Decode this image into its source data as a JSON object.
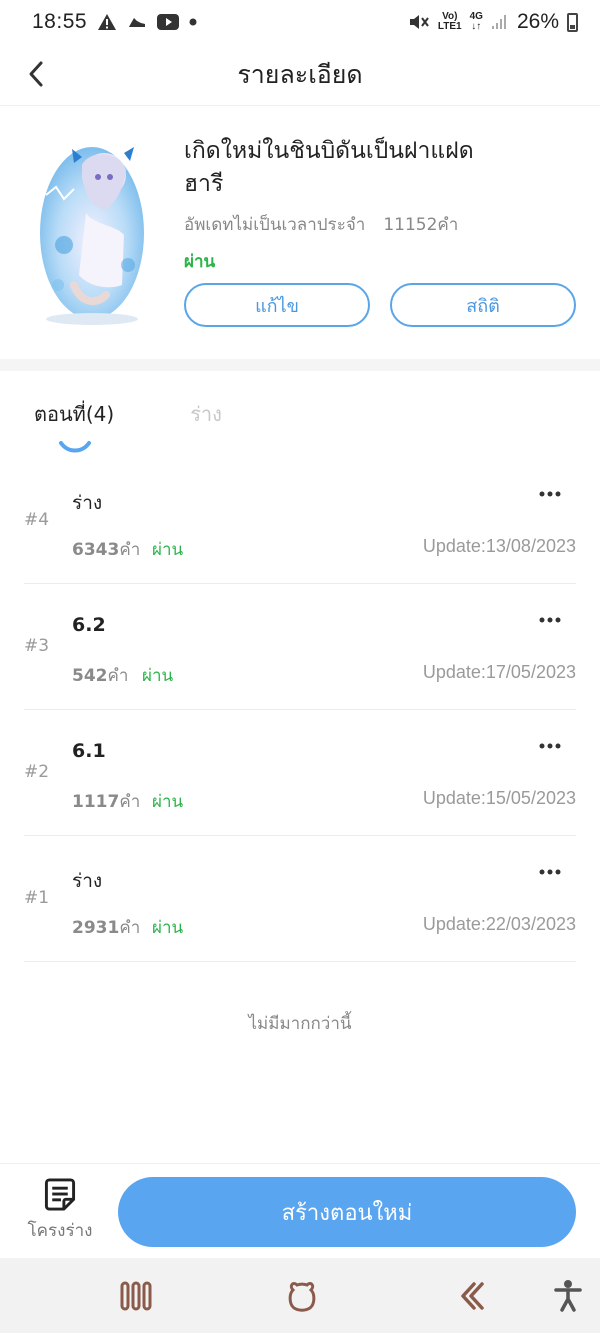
{
  "status_bar": {
    "time": "18:55",
    "battery": "26%",
    "volte": "Vo)",
    "lte": "LTE1",
    "network": "4G"
  },
  "header": {
    "title": "รายละเอียด"
  },
  "book": {
    "title_line1": "เกิดใหม่ในชินบิดันเป็นฝาแฝด",
    "title_line2": "ฮารี",
    "schedule": "อัพเดทไม่เป็นเวลาประจำ",
    "word_count": "11152คำ",
    "status": "ผ่าน",
    "edit_label": "แก้ไข",
    "stats_label": "สถิติ"
  },
  "tabs": {
    "chapters": "ตอนที่(4)",
    "drafts": "ร่าง"
  },
  "chapters": [
    {
      "num": "#4",
      "title": "ร่าง",
      "words": "6343",
      "unit": "คำ",
      "status": "ผ่าน",
      "update": "Update:13/08/2023"
    },
    {
      "num": "#3",
      "title": "6.2",
      "words": "542",
      "unit": "คำ",
      "status": "ผ่าน",
      "update": "Update:17/05/2023"
    },
    {
      "num": "#2",
      "title": "6.1",
      "words": "1117",
      "unit": "คำ",
      "status": "ผ่าน",
      "update": "Update:15/05/2023"
    },
    {
      "num": "#1",
      "title": "ร่าง",
      "words": "2931",
      "unit": "คำ",
      "status": "ผ่าน",
      "update": "Update:22/03/2023"
    }
  ],
  "no_more": "ไม่มีมากกว่านี้",
  "bottom": {
    "draft_label": "โครงร่าง",
    "create_label": "สร้างตอนใหม่"
  },
  "colors": {
    "accent": "#5aa5f0",
    "status_green": "#2cb34a"
  },
  "icons": {
    "back": "chevron-left-icon",
    "more": "more-horizontal-icon",
    "draft": "document-icon",
    "nav_recent": "recent-apps-icon",
    "nav_home": "home-icon",
    "nav_back": "back-icon",
    "accessibility": "accessibility-icon"
  }
}
